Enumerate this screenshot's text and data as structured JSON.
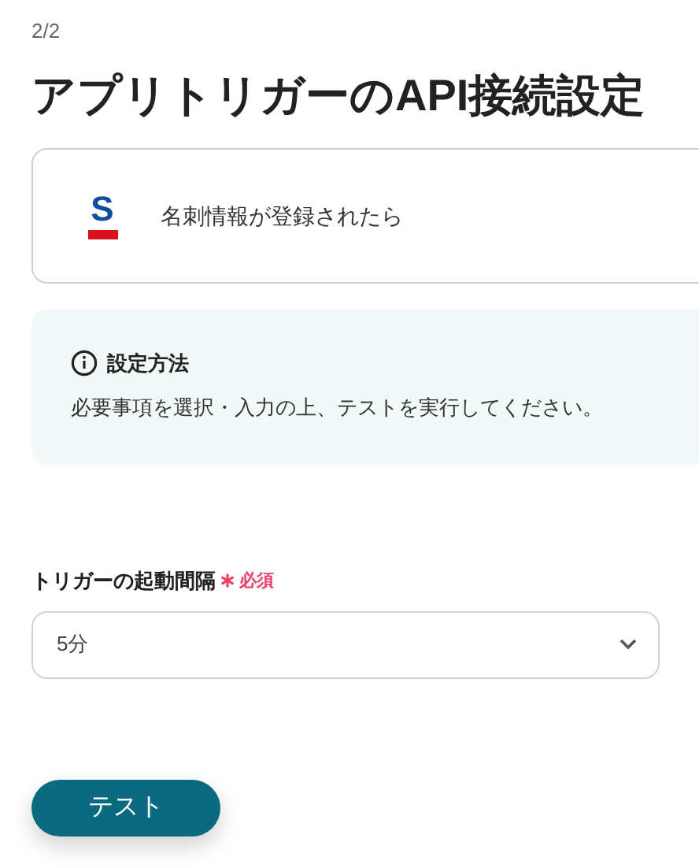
{
  "step": "2/2",
  "title": "アプリトリガーのAPI接続設定",
  "trigger": {
    "logo_text": "S",
    "label": "名刺情報が登録されたら"
  },
  "info": {
    "title": "設定方法",
    "text": "必要事項を選択・入力の上、テストを実行してください。"
  },
  "field": {
    "label": "トリガーの起動間隔",
    "required": true,
    "required_label": "必須",
    "value": "5分"
  },
  "button": "テスト"
}
